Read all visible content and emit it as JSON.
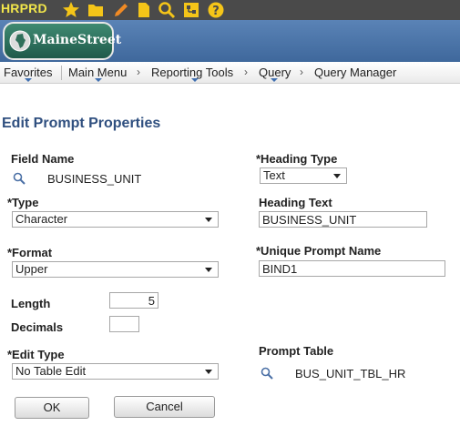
{
  "system": {
    "environment": "HRPRD"
  },
  "icons": {
    "favorites": "star-icon",
    "folder": "folder-icon",
    "edit": "pencil-icon",
    "document": "document-icon",
    "search": "search-icon",
    "tree": "navigator-icon",
    "help": "help-icon"
  },
  "banner": {
    "logo_text": "MaineStreet"
  },
  "nav": {
    "favorites": "Favorites",
    "main_menu": "Main Menu",
    "reporting_tools": "Reporting Tools",
    "query": "Query",
    "query_manager": "Query Manager"
  },
  "page": {
    "title": "Edit Prompt Properties"
  },
  "form": {
    "field_name": {
      "label": "Field Name",
      "value": "BUSINESS_UNIT"
    },
    "heading_type": {
      "label": "*Heading Type",
      "value": "Text"
    },
    "type": {
      "label": "*Type",
      "value": "Character"
    },
    "heading_text": {
      "label": "Heading Text",
      "value": "BUSINESS_UNIT"
    },
    "format": {
      "label": "*Format",
      "value": "Upper"
    },
    "unique_prompt_name": {
      "label": "*Unique Prompt Name",
      "value": "BIND1"
    },
    "length": {
      "label": "Length",
      "value": "5"
    },
    "decimals": {
      "label": "Decimals",
      "value": ""
    },
    "edit_type": {
      "label": "*Edit Type",
      "value": "No Table Edit"
    },
    "prompt_table": {
      "label": "Prompt Table",
      "value": "BUS_UNIT_TBL_HR"
    }
  },
  "buttons": {
    "ok": "OK",
    "cancel": "Cancel"
  },
  "colors": {
    "title": "#2f4f7f",
    "sysbar": "#4a4a4a",
    "env_text": "#f2e64b",
    "banner": "#4a73a8",
    "icon_yellow": "#f5c518"
  }
}
